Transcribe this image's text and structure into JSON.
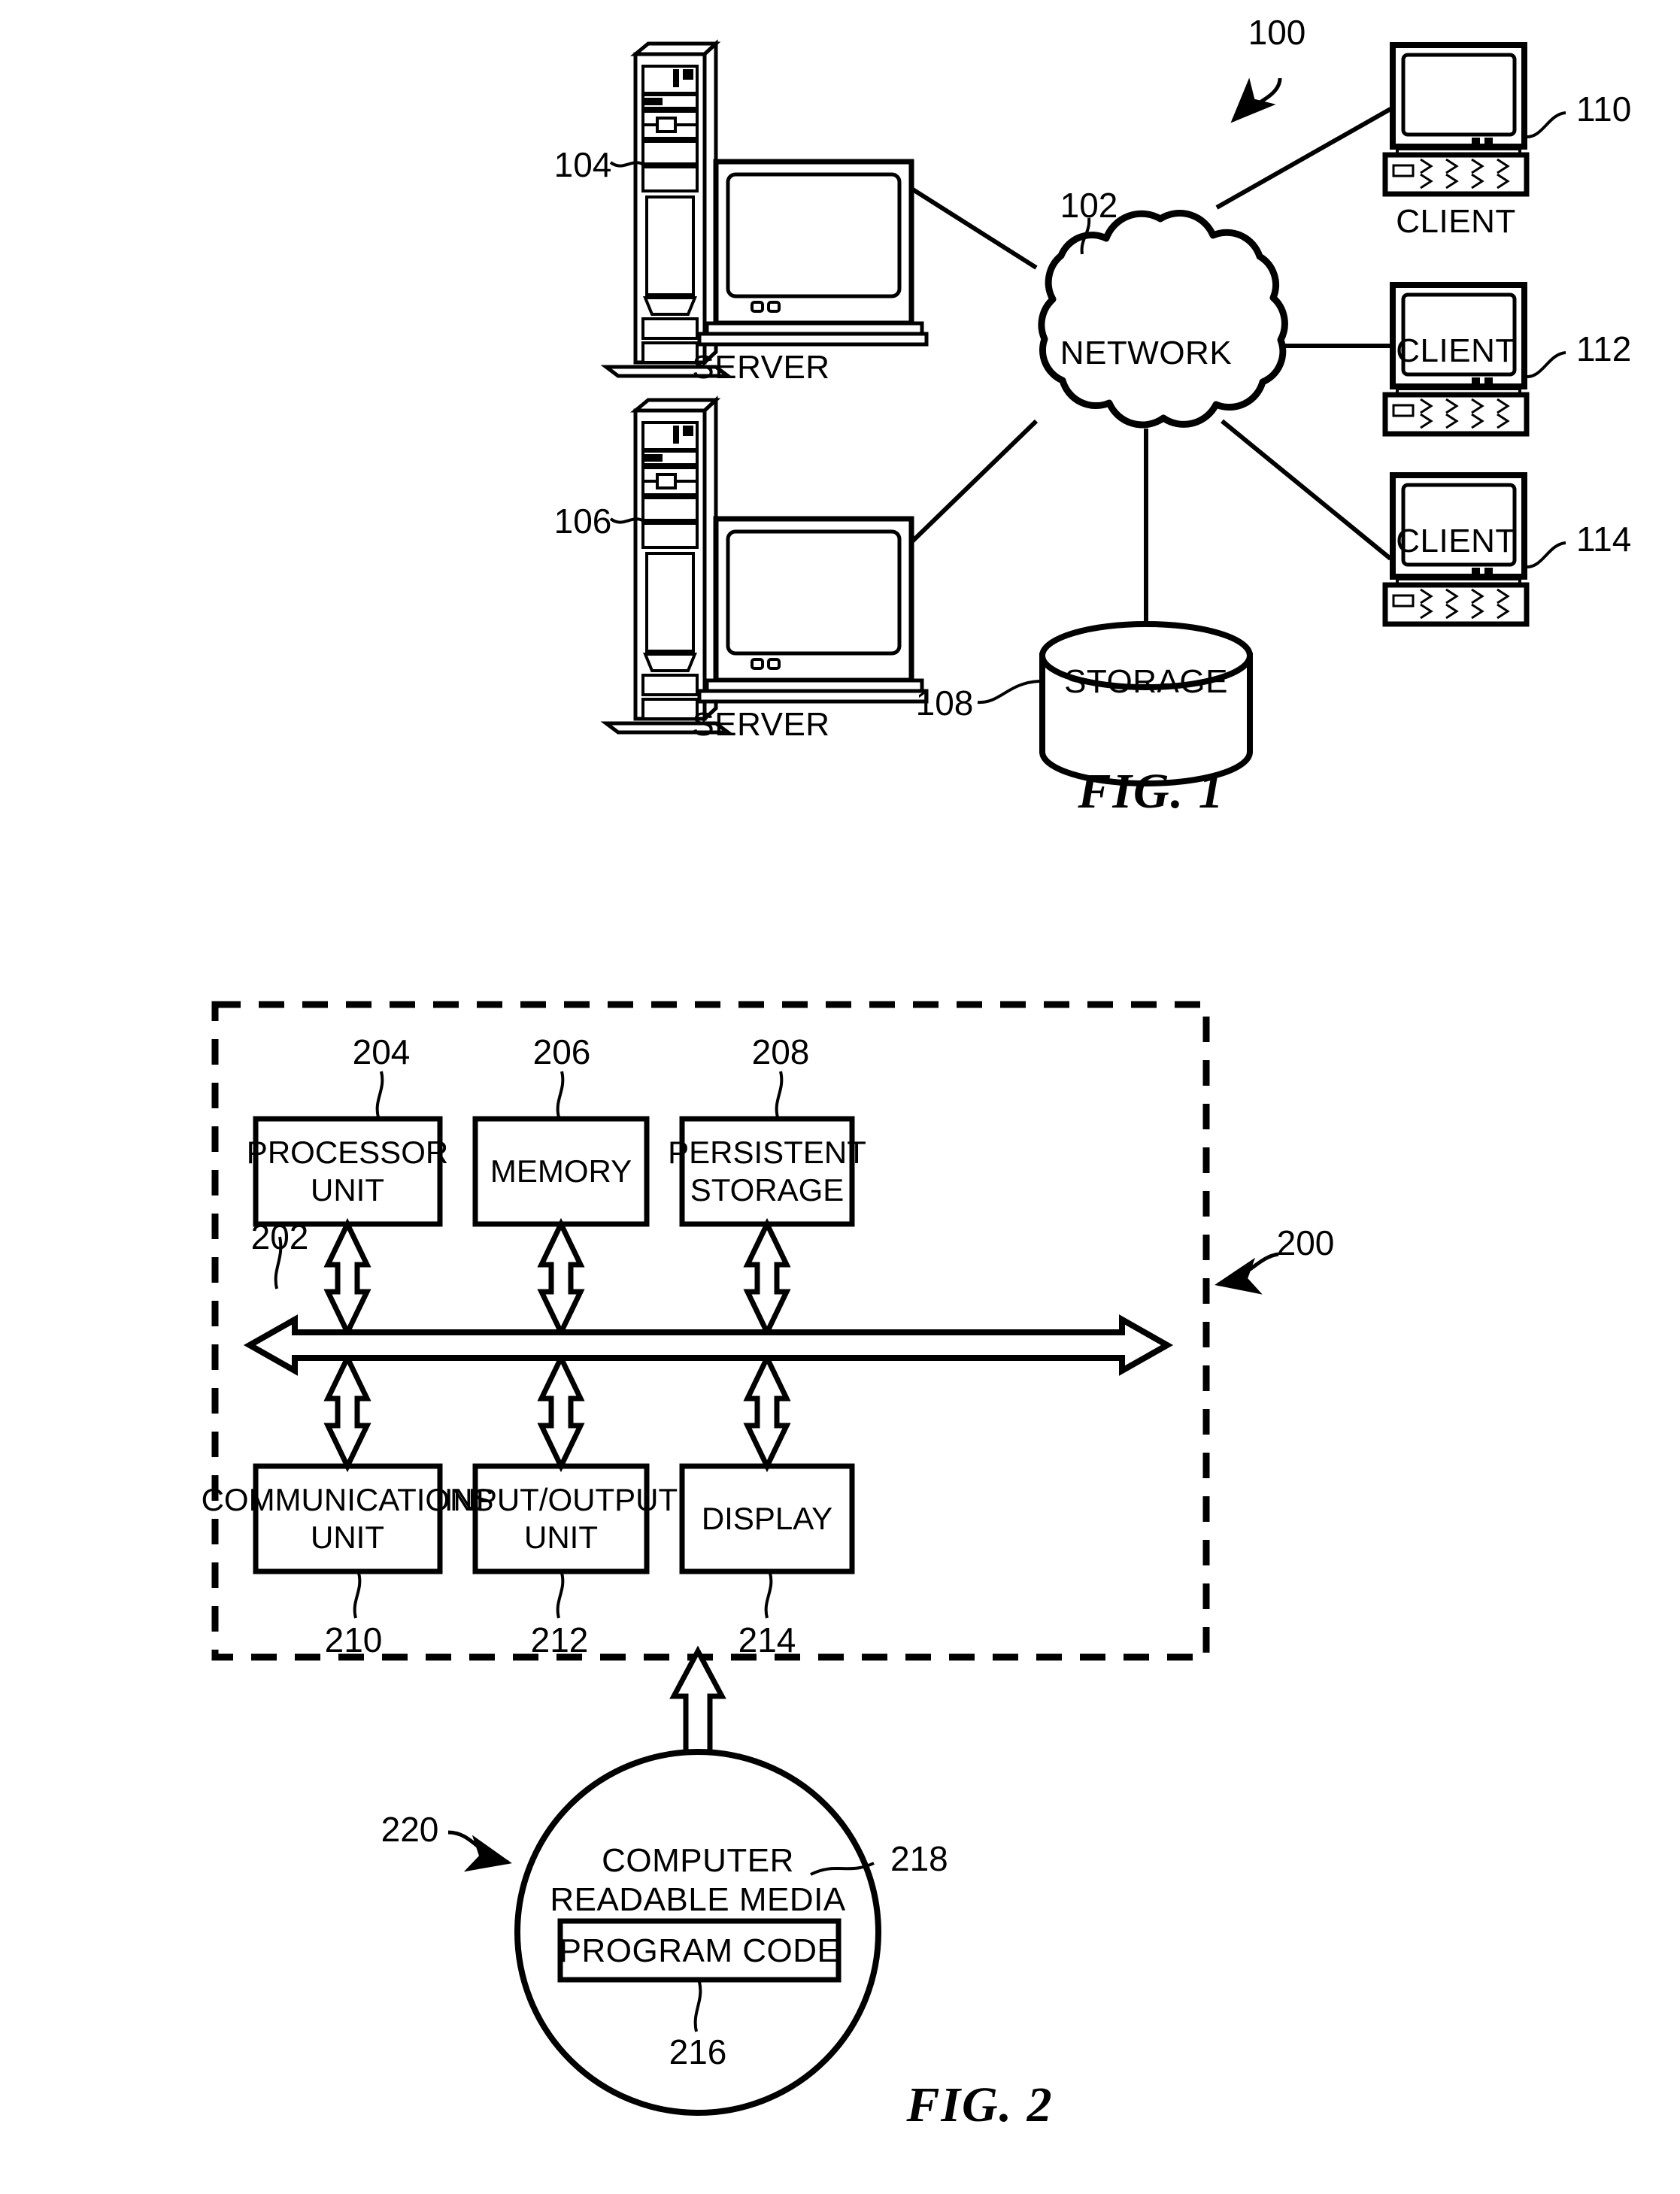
{
  "figure1": {
    "caption": "FIG. 1",
    "system_ref": "100",
    "network": {
      "label": "NETWORK",
      "ref": "102",
      "icon": "cloud-icon"
    },
    "servers": [
      {
        "label": "SERVER",
        "ref": "104",
        "icon": "server-tower-icon"
      },
      {
        "label": "SERVER",
        "ref": "106",
        "icon": "server-tower-icon"
      }
    ],
    "storage": {
      "label": "STORAGE",
      "ref": "108",
      "icon": "database-cylinder-icon"
    },
    "clients": [
      {
        "label": "CLIENT",
        "ref": "110",
        "icon": "desktop-computer-icon"
      },
      {
        "label": "CLIENT",
        "ref": "112",
        "icon": "desktop-computer-icon"
      },
      {
        "label": "CLIENT",
        "ref": "114",
        "icon": "desktop-computer-icon"
      }
    ]
  },
  "figure2": {
    "caption": "FIG. 2",
    "data_processing_system_ref": "200",
    "bus": {
      "ref": "202",
      "icon": "bidirectional-bus-arrow-icon"
    },
    "top_row": [
      {
        "label": "PROCESSOR UNIT",
        "line1": "PROCESSOR",
        "line2": "UNIT",
        "ref": "204"
      },
      {
        "label": "MEMORY",
        "line1": "MEMORY",
        "line2": "",
        "ref": "206"
      },
      {
        "label": "PERSISTENT STORAGE",
        "line1": "PERSISTENT",
        "line2": "STORAGE",
        "ref": "208"
      }
    ],
    "bottom_row": [
      {
        "label": "COMMUNICATIONS UNIT",
        "line1": "COMMUNICATIONS",
        "line2": "UNIT",
        "ref": "210"
      },
      {
        "label": "INPUT/OUTPUT UNIT",
        "line1": "INPUT/OUTPUT",
        "line2": "UNIT",
        "ref": "212"
      },
      {
        "label": "DISPLAY",
        "line1": "DISPLAY",
        "line2": "",
        "ref": "214"
      }
    ],
    "media": {
      "line1": "COMPUTER",
      "line2": "READABLE MEDIA",
      "ref": "218",
      "product_ref": "220",
      "program_code": {
        "label": "PROGRAM CODE",
        "ref": "216"
      }
    }
  },
  "colors": {
    "ink": "#000000",
    "paper": "#ffffff"
  }
}
